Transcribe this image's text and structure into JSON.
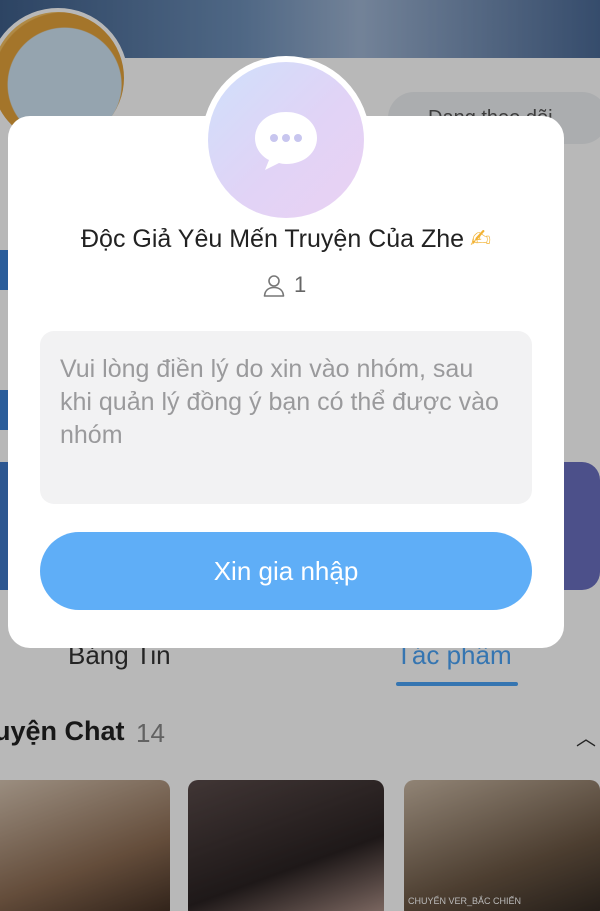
{
  "background": {
    "follow_label": "Đang theo dõi",
    "tabs": {
      "news_label": "Bảng Tin",
      "works_label": "Tác phẩm"
    },
    "section": {
      "title": "uyện Chat",
      "count": "14"
    },
    "card_caption": "CHUYỂN VER_BẮC CHIẾN"
  },
  "modal": {
    "group_name": "Độc Giả Yêu Mến Truyện Của Zhe",
    "group_name_emoji": "✍",
    "member_count": "1",
    "reason_placeholder": "Vui lòng điền lý do xin vào nhóm, sau khi quản lý đồng ý bạn có thể được vào nhóm",
    "join_button_label": "Xin gia nhập"
  },
  "colors": {
    "accent": "#5faef7",
    "tab_active": "#4aa3f5"
  },
  "icons": {
    "group_avatar": "chat-bubble-icon",
    "members": "person-icon"
  }
}
